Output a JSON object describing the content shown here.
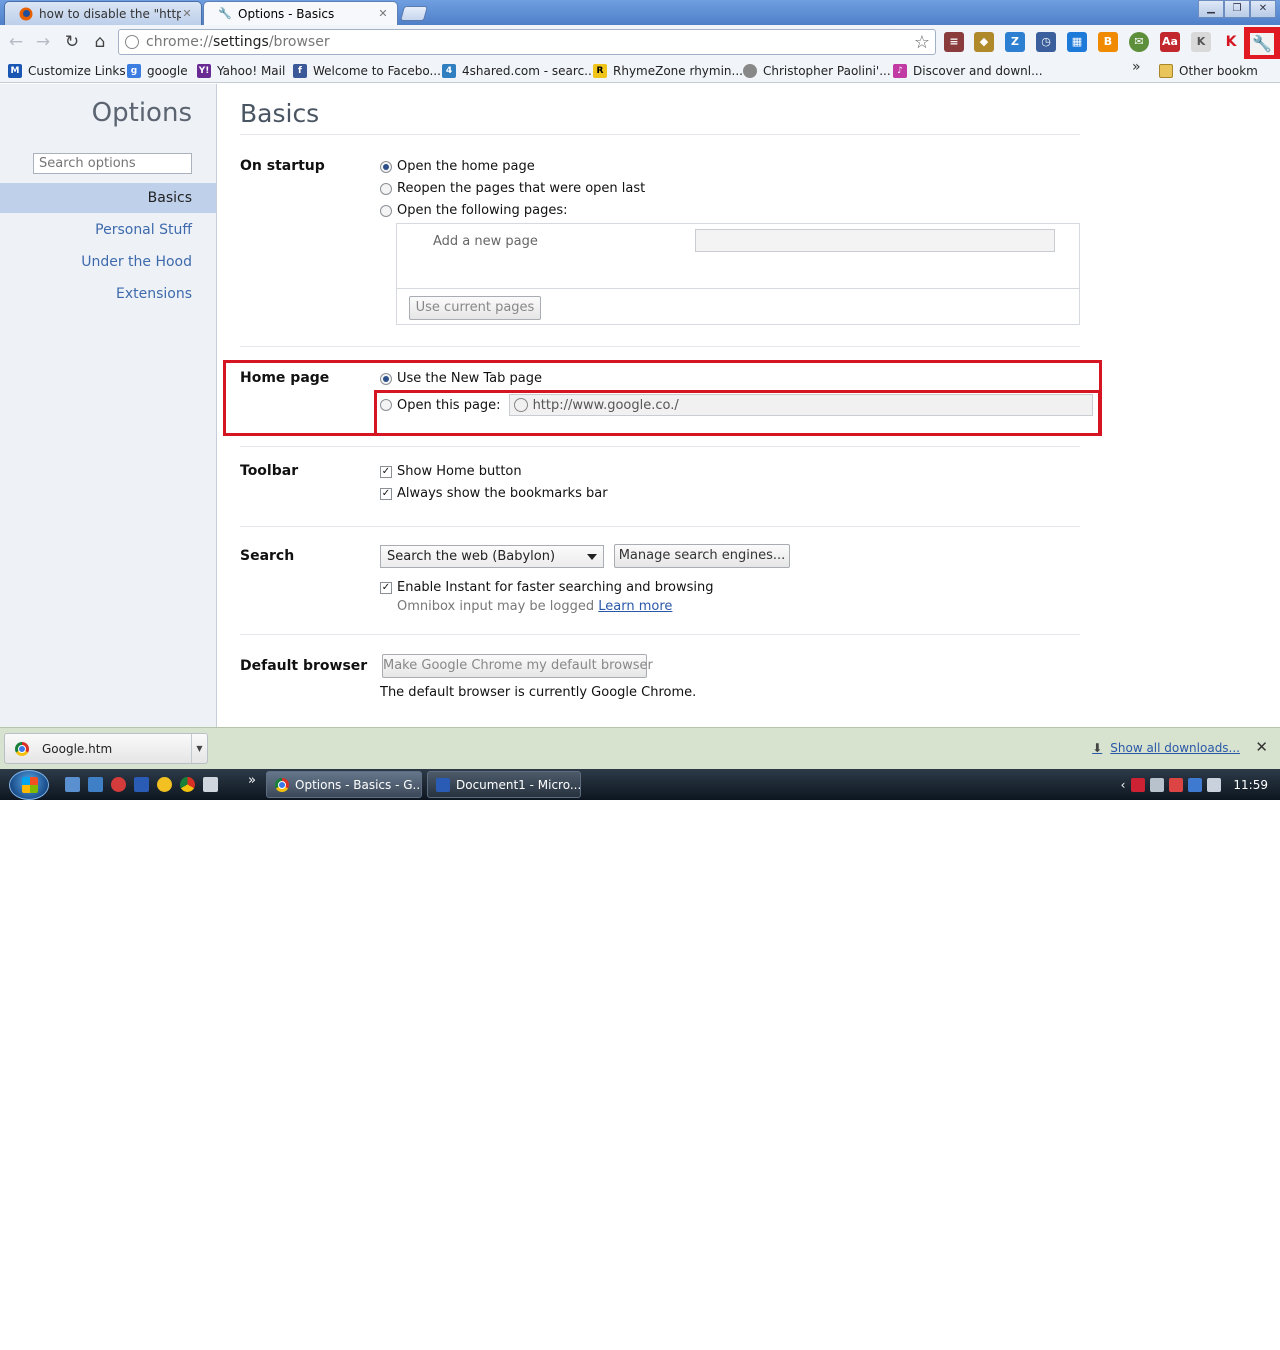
{
  "tabs": [
    {
      "title": "how to disable the \"http://v",
      "active": false
    },
    {
      "title": "Options - Basics",
      "active": true
    }
  ],
  "toolbar": {
    "url_scheme": "chrome://",
    "url_host": "settings",
    "url_path": "/browser"
  },
  "bookmarks": [
    {
      "label": "Customize Links",
      "icon": "M",
      "color": "#1a56b4"
    },
    {
      "label": "google",
      "icon": "g",
      "color": "#3b7de0"
    },
    {
      "label": "Yahoo! Mail",
      "icon": "Y!",
      "color": "#6a2a93"
    },
    {
      "label": "Welcome to Facebo...",
      "icon": "f",
      "color": "#3b5998"
    },
    {
      "label": "4shared.com - searc...",
      "icon": "4",
      "color": "#2f7fc1"
    },
    {
      "label": "RhymeZone rhymin...",
      "icon": "R",
      "color": "#f0c419"
    },
    {
      "label": "Christopher Paolini'...",
      "icon": "",
      "color": "#888888"
    },
    {
      "label": "Discover and downl...",
      "icon": "♪",
      "color": "#c23aa3"
    }
  ],
  "bookmarks_more": "»",
  "other_bookmarks": "Other bookm",
  "sidebar": {
    "title": "Options",
    "search_placeholder": "Search options",
    "items": [
      {
        "label": "Basics",
        "selected": true
      },
      {
        "label": "Personal Stuff",
        "selected": false
      },
      {
        "label": "Under the Hood",
        "selected": false
      },
      {
        "label": "Extensions",
        "selected": false
      }
    ]
  },
  "main": {
    "title": "Basics",
    "startup": {
      "label": "On startup",
      "opt_home": "Open the home page",
      "opt_reopen": "Reopen the pages that were open last",
      "opt_following": "Open the following pages:",
      "add_page": "Add a new page",
      "use_current": "Use current pages"
    },
    "homepage": {
      "label": "Home page",
      "opt_newtab": "Use the New Tab page",
      "opt_open": "Open this page:",
      "url": "http://www.google.co./"
    },
    "toolbar": {
      "label": "Toolbar",
      "show_home": "Show Home button",
      "show_bookmarks": "Always show the bookmarks bar"
    },
    "search": {
      "label": "Search",
      "engine": "Search the web (Babylon)",
      "manage": "Manage search engines...",
      "instant": "Enable Instant for faster searching and browsing",
      "note": "Omnibox input may be logged",
      "learn_more": "Learn more"
    },
    "default_browser": {
      "label": "Default browser",
      "button": "Make Google Chrome my default browser",
      "status": "The default browser is currently Google Chrome."
    }
  },
  "downloads": {
    "file": "Google.htm",
    "show_all": "Show all downloads..."
  },
  "taskbar": {
    "windows": [
      "Options - Basics - G...",
      "Document1 - Micro..."
    ],
    "chevron": "»",
    "clock": "11:59"
  },
  "colors": {
    "highlight": "#d51622",
    "link": "#3e6aad"
  }
}
